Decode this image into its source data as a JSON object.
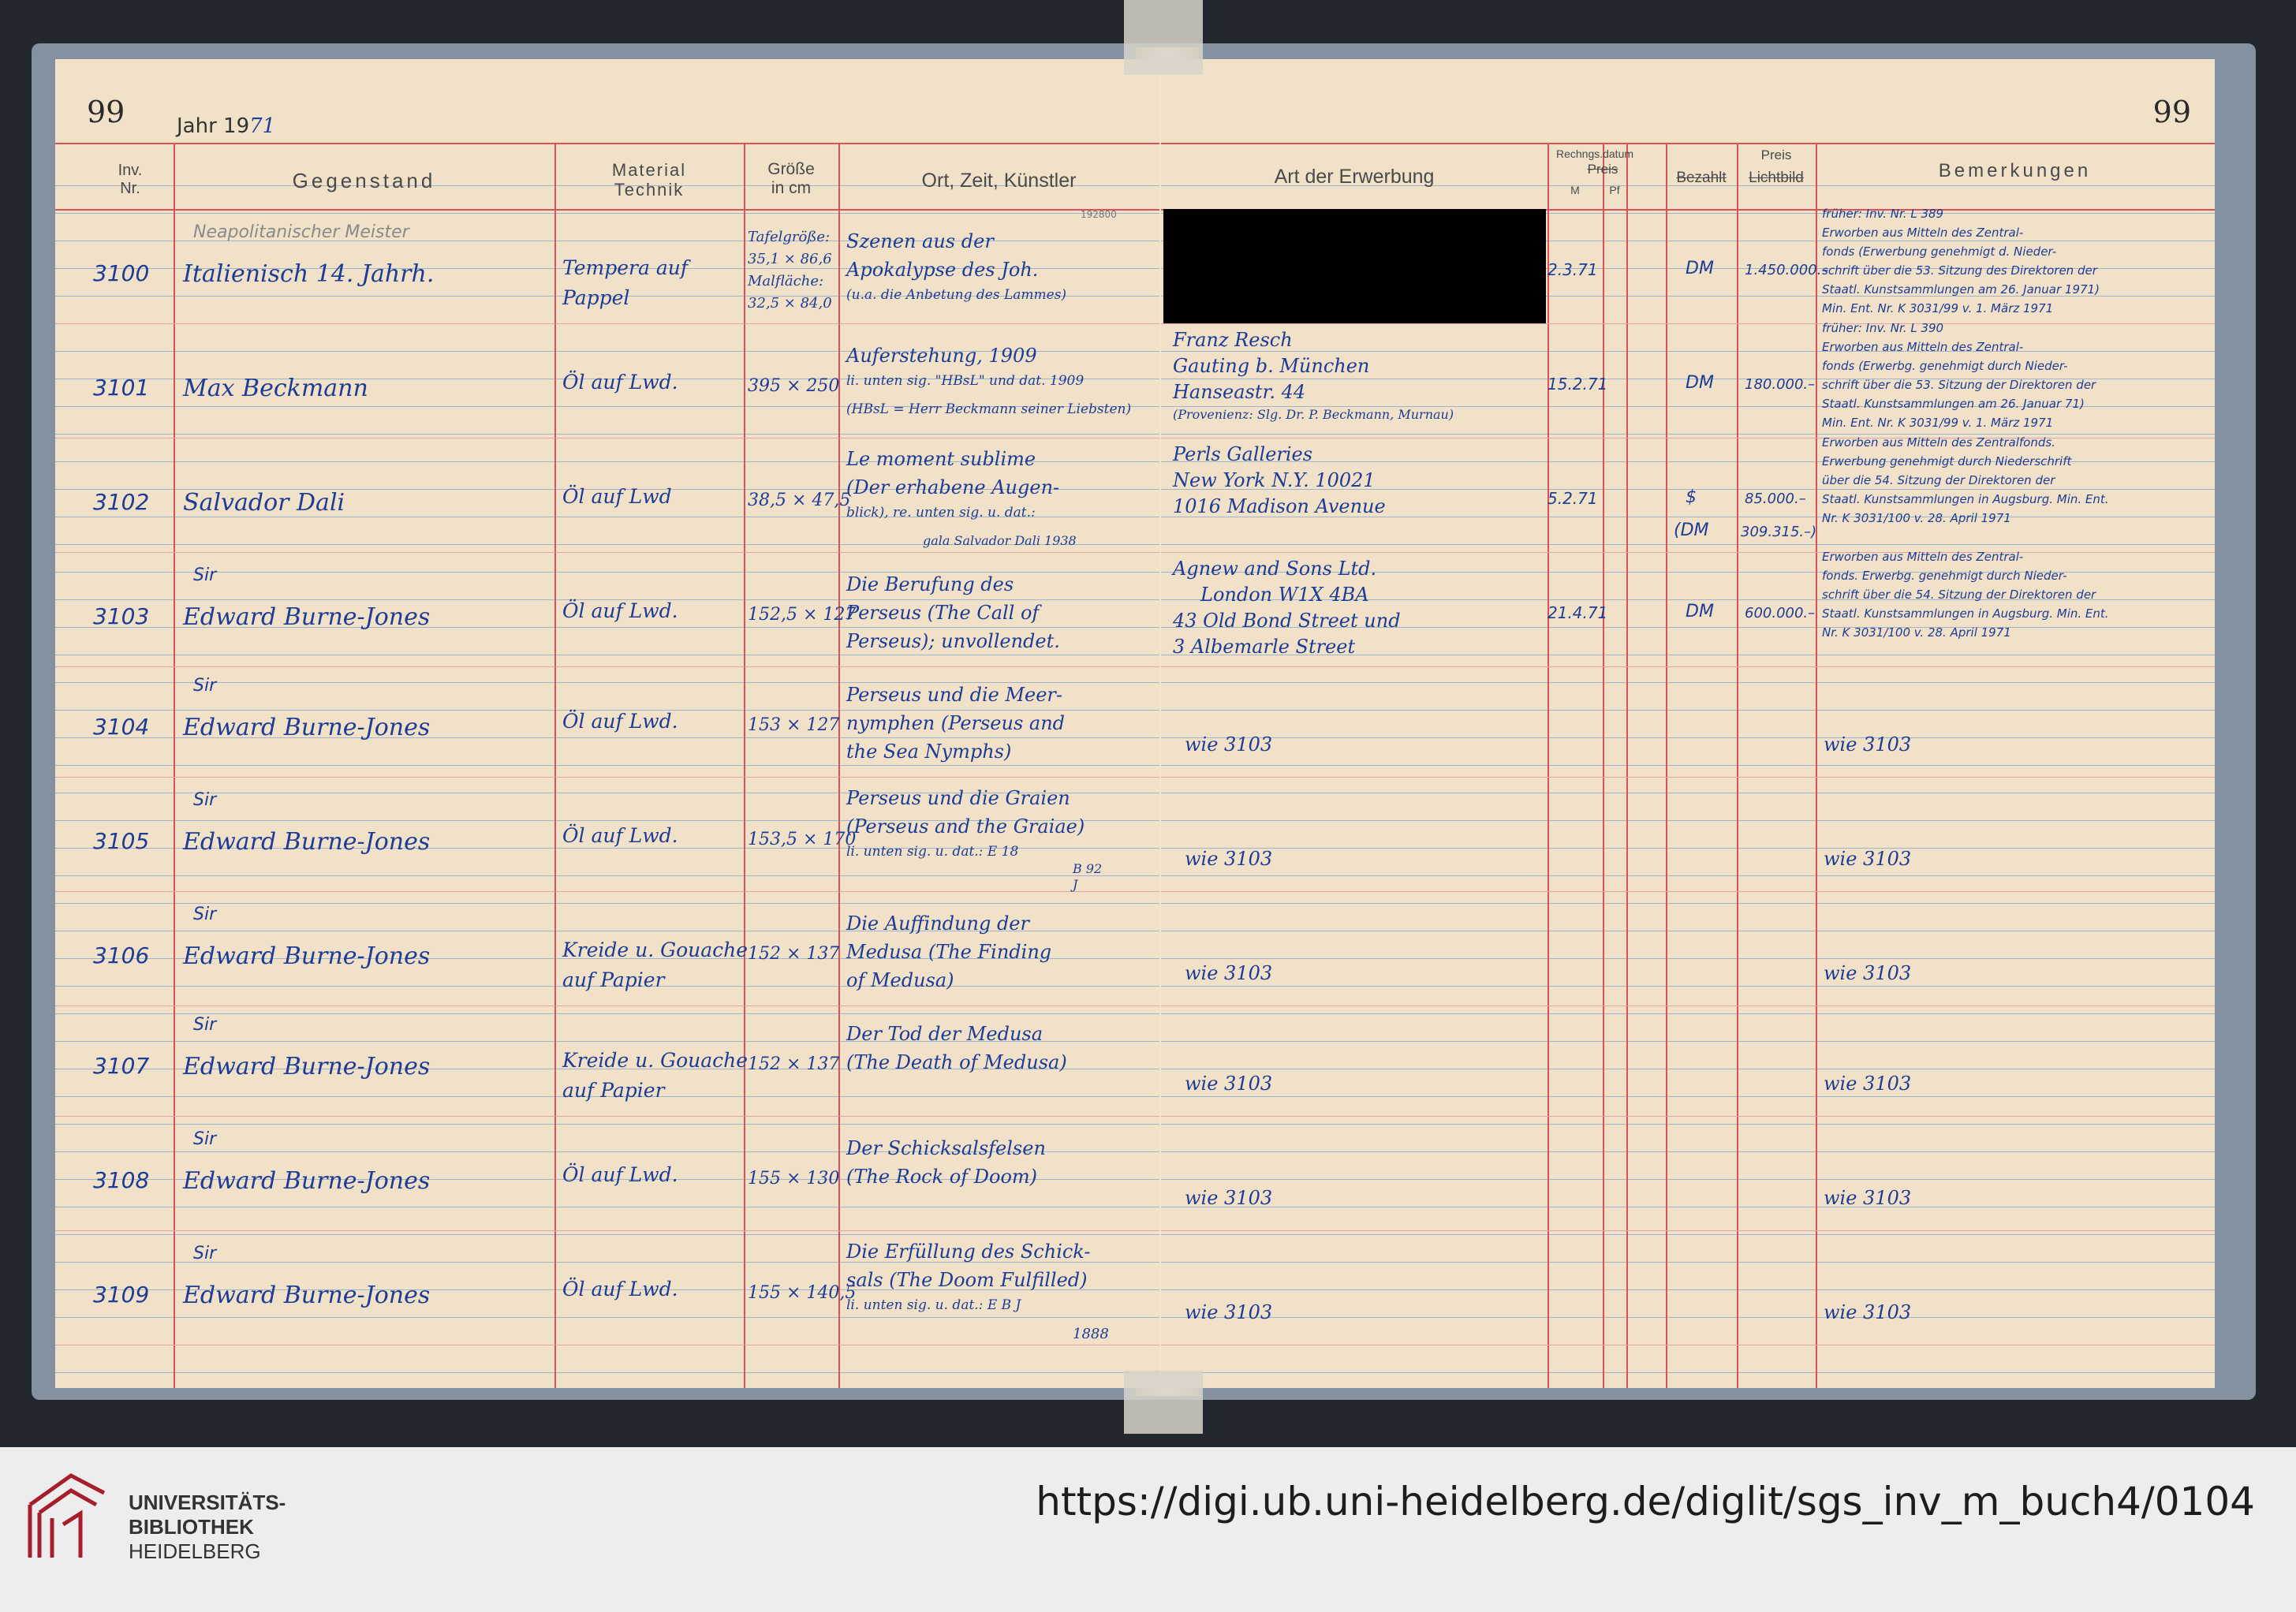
{
  "page": {
    "page_number_left": "99",
    "page_number_right": "99",
    "year_prefix": "Jahr 19",
    "year_suffix": "71"
  },
  "columns_left": {
    "inv": "Inv.\nNr.",
    "gegenstand": "Gegenstand",
    "material": "Material\nTechnik",
    "groesse": "Größe\nin cm",
    "ort": "Ort, Zeit, Künstler"
  },
  "columns_right": {
    "erwerbung": "Art der Erwerbung",
    "rechnungsdatum": "Rechngs.datum",
    "preis_struck": "Preis",
    "waehrung_m": "M",
    "waehrung_pf": "Pf",
    "bezahlt": "Bezahlt",
    "preis_top": "Preis",
    "lichtbild": "Lichtbild",
    "bemerkungen": "Bemerkungen"
  },
  "stamp": "192800",
  "rows": [
    {
      "nr": "3100",
      "above": "Neapolitanischer Meister",
      "gegenstand": "Italienisch 14. Jahrh.",
      "material": [
        "Tempera auf",
        "Pappel"
      ],
      "groesse": [
        "Tafelgröße:",
        "35,1 × 86,6",
        "Malfläche:",
        "32,5 × 84,0"
      ],
      "ort": [
        "Szenen aus der",
        "Apokalypse des Joh.",
        "(u.a. die Anbetung des Lammes)"
      ],
      "erwerbung": [],
      "datum": "2.3.71",
      "waehrung": "DM",
      "preis": "1.450.000.–",
      "bemerkungen": [
        "früher: Inv. Nr. L 389",
        "Erworben aus Mitteln des Zentral-",
        "fonds (Erwerbung genehmigt d. Nieder-",
        "schrift über die 53. Sitzung des Direktoren der",
        "Staatl. Kunstsammlungen am 26. Januar 1971)",
        "Min. Ent. Nr. K 3031/99 v. 1. März 1971"
      ]
    },
    {
      "nr": "3101",
      "above": "",
      "gegenstand": "Max Beckmann",
      "material": [
        "Öl auf Lwd."
      ],
      "groesse": [
        "395 × 250"
      ],
      "ort": [
        "Auferstehung, 1909",
        "li. unten sig. \"HBsL\" und dat. 1909",
        "(HBsL = Herr Beckmann seiner Liebsten)"
      ],
      "erwerbung": [
        "Franz Resch",
        "Gauting b. München",
        "Hanseastr. 44",
        "(Provenienz: Slg. Dr. P. Beckmann, Murnau)"
      ],
      "datum": "15.2.71",
      "waehrung": "DM",
      "preis": "180.000.–",
      "bemerkungen": [
        "früher: Inv. Nr. L 390",
        "Erworben aus Mitteln des Zentral-",
        "fonds (Erwerbg. genehmigt durch Nieder-",
        "schrift über die 53. Sitzung der Direktoren der",
        "Staatl. Kunstsammlungen am 26. Januar 71)",
        "Min. Ent. Nr. K 3031/99 v. 1. März 1971"
      ]
    },
    {
      "nr": "3102",
      "above": "",
      "gegenstand": "Salvador Dali",
      "material": [
        "Öl auf Lwd"
      ],
      "groesse": [
        "38,5 × 47,5"
      ],
      "ort": [
        "Le moment sublime",
        "(Der erhabene Augen-",
        "blick), re. unten sig. u. dat.:",
        "gala Salvador Dali 1938"
      ],
      "erwerbung": [
        "Perls Galleries",
        "New York N.Y. 10021",
        "1016 Madison Avenue"
      ],
      "datum": "5.2.71",
      "waehrung": "$",
      "waehrung2": "(DM",
      "preis": "85.000.–",
      "preis2": "309.315.–)",
      "bemerkungen": [
        "Erworben aus Mitteln des Zentralfonds.",
        "Erwerbung genehmigt durch Niederschrift",
        "über die 54. Sitzung der Direktoren der",
        "Staatl. Kunstsammlungen in Augsburg. Min. Ent.",
        "Nr. K 3031/100 v. 28. April 1971"
      ]
    },
    {
      "nr": "3103",
      "above": "Sir",
      "gegenstand": "Edward Burne-Jones",
      "material": [
        "Öl auf Lwd."
      ],
      "groesse": [
        "152,5 × 127"
      ],
      "ort": [
        "Die Berufung des",
        "Perseus (The Call of",
        "Perseus); unvollendet."
      ],
      "erwerbung": [
        "Agnew and Sons Ltd.",
        "London W1X 4BA",
        "43 Old Bond Street und",
        "3 Albemarle Street"
      ],
      "datum": "21.4.71",
      "waehrung": "DM",
      "preis": "600.000.–",
      "bemerkungen": [
        "Erworben aus Mitteln des Zentral-",
        "fonds. Erwerbg. genehmigt durch Nieder-",
        "schrift über die 54. Sitzung der Direktoren der",
        "Staatl. Kunstsammlungen in Augsburg. Min. Ent.",
        "Nr. K 3031/100 v. 28. April 1971"
      ]
    },
    {
      "nr": "3104",
      "above": "Sir",
      "gegenstand": "Edward Burne-Jones",
      "material": [
        "Öl auf Lwd."
      ],
      "groesse": [
        "153 × 127"
      ],
      "ort": [
        "Perseus und die Meer-",
        "nymphen (Perseus and",
        "the Sea Nymphs)"
      ],
      "erwerbung": [
        "wie 3103"
      ],
      "bemerkungen": [
        "wie 3103"
      ]
    },
    {
      "nr": "3105",
      "above": "Sir",
      "gegenstand": "Edward Burne-Jones",
      "material": [
        "Öl auf Lwd."
      ],
      "groesse": [
        "153,5 × 170"
      ],
      "ort": [
        "Perseus und die Graien",
        "(Perseus and the Graiae)",
        "li. unten sig. u. dat.: E 18",
        "B 92",
        "J"
      ],
      "erwerbung": [
        "wie 3103"
      ],
      "bemerkungen": [
        "wie 3103"
      ]
    },
    {
      "nr": "3106",
      "above": "Sir",
      "gegenstand": "Edward Burne-Jones",
      "material": [
        "Kreide u. Gouache",
        "auf Papier"
      ],
      "groesse": [
        "152 × 137"
      ],
      "ort": [
        "Die Auffindung der",
        "Medusa (The Finding",
        "of Medusa)"
      ],
      "erwerbung": [
        "wie 3103"
      ],
      "bemerkungen": [
        "wie 3103"
      ]
    },
    {
      "nr": "3107",
      "above": "Sir",
      "gegenstand": "Edward Burne-Jones",
      "material": [
        "Kreide u. Gouache",
        "auf Papier"
      ],
      "groesse": [
        "152 × 137"
      ],
      "ort": [
        "Der Tod der Medusa",
        "(The Death of Medusa)"
      ],
      "erwerbung": [
        "wie 3103"
      ],
      "bemerkungen": [
        "wie 3103"
      ]
    },
    {
      "nr": "3108",
      "above": "Sir",
      "gegenstand": "Edward Burne-Jones",
      "material": [
        "Öl auf Lwd."
      ],
      "groesse": [
        "155 × 130"
      ],
      "ort": [
        "Der Schicksalsfelsen",
        "(The Rock of Doom)"
      ],
      "erwerbung": [
        "wie 3103"
      ],
      "bemerkungen": [
        "wie 3103"
      ]
    },
    {
      "nr": "3109",
      "above": "Sir",
      "gegenstand": "Edward Burne-Jones",
      "material": [
        "Öl auf Lwd."
      ],
      "groesse": [
        "155 × 140,5"
      ],
      "ort": [
        "Die Erfüllung des Schick-",
        "sals (The Doom Fulfilled)",
        "li. unten sig. u. dat.: E B J",
        "1888"
      ],
      "erwerbung": [
        "wie 3103"
      ],
      "bemerkungen": [
        "wie 3103"
      ]
    }
  ],
  "footer": {
    "logo_line1": "UNIVERSITÄTS-",
    "logo_line2": "BIBLIOTHEK",
    "logo_line3": "HEIDELBERG",
    "url": "https://digi.ub.uni-heidelberg.de/diglit/sgs_inv_m_buch4/0104"
  },
  "colors": {
    "ink": "#1d3c96",
    "red_rule": "#d85058",
    "blue_rule": "#9db5c8",
    "paper": "#f1e1c8"
  }
}
